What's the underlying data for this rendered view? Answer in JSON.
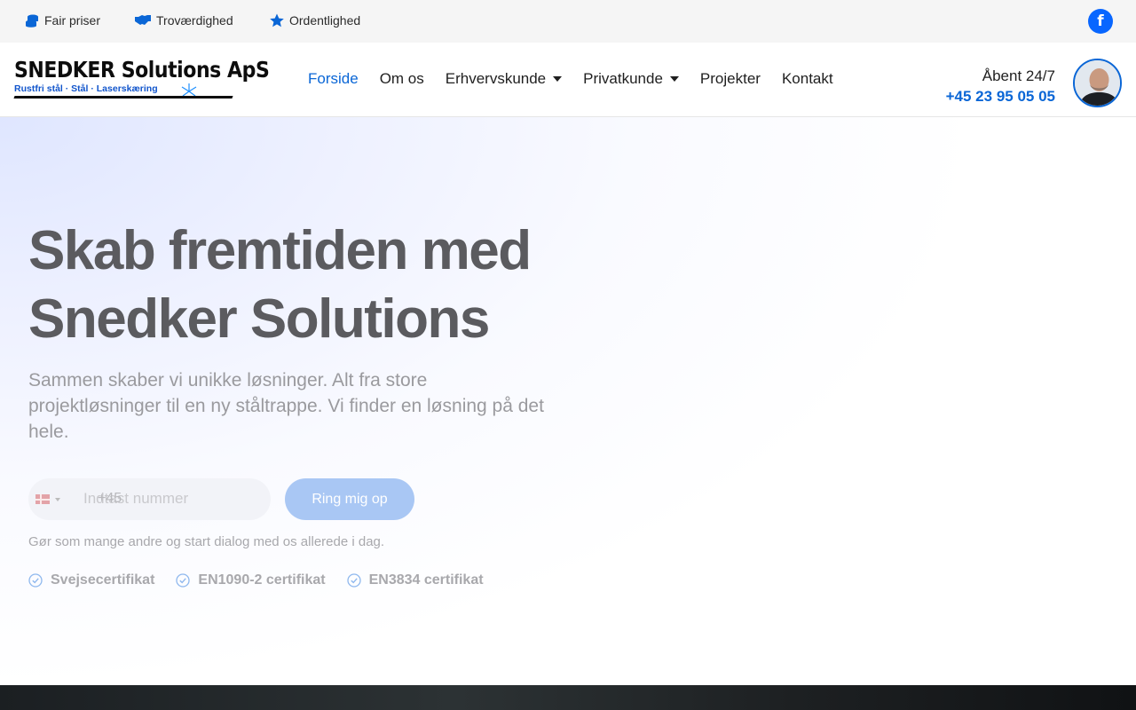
{
  "topbar": {
    "usps": [
      {
        "label": "Fair priser",
        "icon": "coins-icon"
      },
      {
        "label": "Troværdighed",
        "icon": "handshake-icon"
      },
      {
        "label": "Ordentlighed",
        "icon": "star-icon"
      }
    ],
    "facebook_glyph": "f"
  },
  "header": {
    "logo": {
      "title": "SNEDKER Solutions ApS",
      "subtitle": "Rustfri stål · Stål · Laserskæring"
    },
    "nav": [
      {
        "label": "Forside",
        "active": true
      },
      {
        "label": "Om os"
      },
      {
        "label": "Erhvervskunde",
        "has_dropdown": true
      },
      {
        "label": "Privatkunde",
        "has_dropdown": true
      },
      {
        "label": "Projekter"
      },
      {
        "label": "Kontakt"
      }
    ],
    "open_hours": "Åbent 24/7",
    "phone": "+45 23 95 05 05"
  },
  "hero": {
    "heading_line1": "Skab fremtiden med",
    "heading_line2": "Snedker Solutions",
    "lead": "Sammen skaber vi unikke løsninger. Alt fra store projektløsninger til en ny ståltrappe. Vi finder en løsning på det hele.",
    "phone_input": {
      "country_code": "+45",
      "placeholder": "Indtast nummer"
    },
    "cta_label": "Ring mig op",
    "note": "Gør som mange andre og start dialog med os allerede i dag.",
    "certs": [
      "Svejsecertifikat",
      "EN1090-2 certifikat",
      "EN3834 certifikat"
    ]
  },
  "colors": {
    "accent": "#0a66d6",
    "facebook": "#0866ff",
    "cta_faded": "#a9c7f4"
  }
}
